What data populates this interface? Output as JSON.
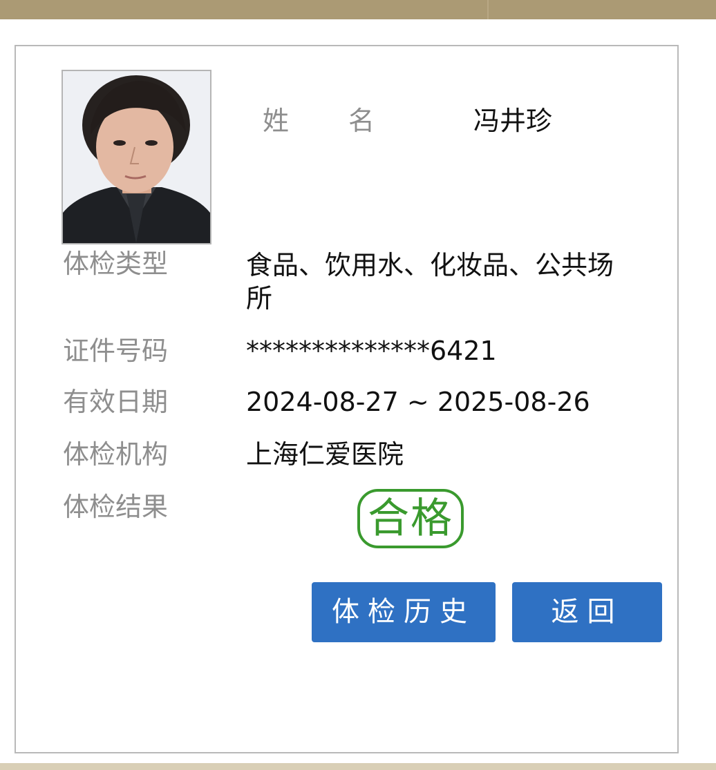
{
  "header": {
    "accent_color": "#ab9a74"
  },
  "card": {
    "photo_alt": "avatar",
    "name": {
      "label": "姓名",
      "value": "冯井珍"
    },
    "fields": [
      {
        "key": "exam_type",
        "label": "体检类型",
        "value": "食品、饮用水、化妆品、公共场所"
      },
      {
        "key": "id_number",
        "label": "证件号码",
        "value": "**************6421"
      },
      {
        "key": "valid_period",
        "label": "有效日期",
        "value": "2024-08-27 ~ 2025-08-26"
      },
      {
        "key": "institution",
        "label": "体检机构",
        "value": "上海仁爱医院"
      },
      {
        "key": "result",
        "label": "体检结果",
        "value": "合格"
      }
    ],
    "result_color": "#3a9a2e"
  },
  "buttons": {
    "history_label": "体检历史",
    "back_label": "返回",
    "color": "#2f71c3"
  }
}
